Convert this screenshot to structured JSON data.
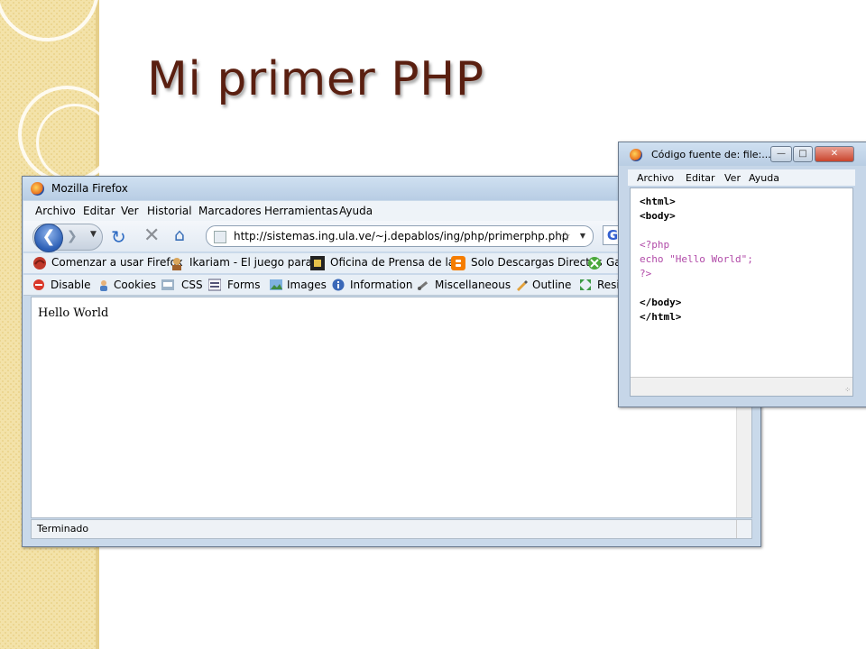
{
  "slide": {
    "title": "Mi primer PHP"
  },
  "browser": {
    "window_title": "Mozilla Firefox",
    "menu": [
      "Archivo",
      "Editar",
      "Ver",
      "Historial",
      "Marcadores",
      "Herramientas",
      "Ayuda"
    ],
    "url": "http://sistemas.ing.ula.ve/~j.depablos/ing/php/primerphp.php",
    "search_engine_glyph": "G",
    "bookmarks": [
      "Comenzar a usar Firefox",
      "Ikariam - El juego para...",
      "Oficina de Prensa de la...",
      "Solo Descargas Directas",
      "Ga"
    ],
    "dev_toolbar": [
      "Disable",
      "Cookies",
      "CSS",
      "Forms",
      "Images",
      "Information",
      "Miscellaneous",
      "Outline",
      "Resiz"
    ],
    "page_content": "Hello World",
    "status": "Terminado"
  },
  "source_view": {
    "window_title": "Código fuente de: file:...",
    "menu": [
      "Archivo",
      "Editar",
      "Ver",
      "Ayuda"
    ],
    "lines": [
      "<html>",
      "<body>",
      "",
      "<?php",
      "echo \"Hello World\";",
      "?>",
      "",
      "</body>",
      "</html>"
    ]
  },
  "colors": {
    "title": "#5a1f10",
    "php_code": "#b14aa8",
    "slide_band": "#f3e2a9"
  }
}
